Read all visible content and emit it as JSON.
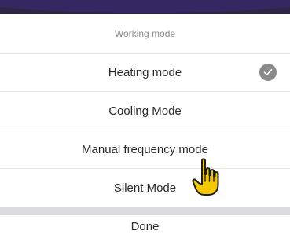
{
  "sheet": {
    "title": "Working mode",
    "options": [
      {
        "label": "Heating mode",
        "selected": true
      },
      {
        "label": "Cooling Mode",
        "selected": false
      },
      {
        "label": "Manual frequency mode",
        "selected": false
      },
      {
        "label": "Silent Mode",
        "selected": false
      }
    ],
    "done_label": "Done"
  },
  "colors": {
    "header_bar": "#2b2744",
    "check_badge": "#8a8a8a",
    "separator": "#dcdce0",
    "pointer_fill": "#f5c800"
  },
  "icons": {
    "selected": "checkmark-icon",
    "cursor": "hand-pointer-icon"
  }
}
